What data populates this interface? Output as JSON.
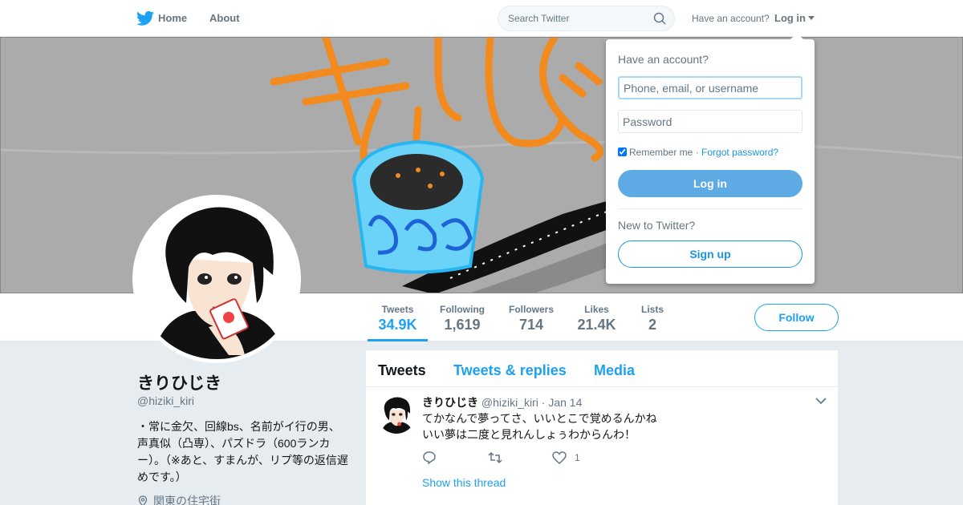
{
  "nav": {
    "home_label": "Home",
    "about_label": "About",
    "search_placeholder": "Search Twitter",
    "have_account_label": "Have an account?",
    "login_label": "Log in"
  },
  "profile": {
    "name": "きりひじき",
    "handle": "@hiziki_kiri",
    "bio": "・常に金欠、回線bs、名前がイ行の男、声真似（凸専）、パズドラ（600ランカー）。（※あと、すまんが、リプ等の返信遅めです。）",
    "location": "関東の住宅街"
  },
  "stats": [
    {
      "label": "Tweets",
      "value": "34.9K",
      "active": true
    },
    {
      "label": "Following",
      "value": "1,619"
    },
    {
      "label": "Followers",
      "value": "714"
    },
    {
      "label": "Likes",
      "value": "21.4K"
    },
    {
      "label": "Lists",
      "value": "2"
    }
  ],
  "follow_label": "Follow",
  "timeline": {
    "tabs": [
      "Tweets",
      "Tweets & replies",
      "Media"
    ],
    "tweet": {
      "name": "きりひじき",
      "handle": "@hiziki_kiri",
      "separator": "·",
      "date": "Jan 14",
      "line1": "てかなんで夢ってさ、いいとこで覚めるんかね",
      "line2": "いい夢は二度と見れんしょぅわからんわ！",
      "like_count": "1",
      "show_thread": "Show this thread"
    }
  },
  "login_dropdown": {
    "title": "Have an account?",
    "username_placeholder": "Phone, email, or username",
    "password_placeholder": "Password",
    "remember_label": "Remember me",
    "separator": "·",
    "forgot_label": "Forgot password?",
    "login_button": "Log in",
    "new_label": "New to Twitter?",
    "signup_button": "Sign up"
  },
  "colors": {
    "accent": "#1da1f2",
    "login_button": "#5eaae4",
    "banner_bg": "#ababab",
    "banner_text": "#f28a1e"
  }
}
